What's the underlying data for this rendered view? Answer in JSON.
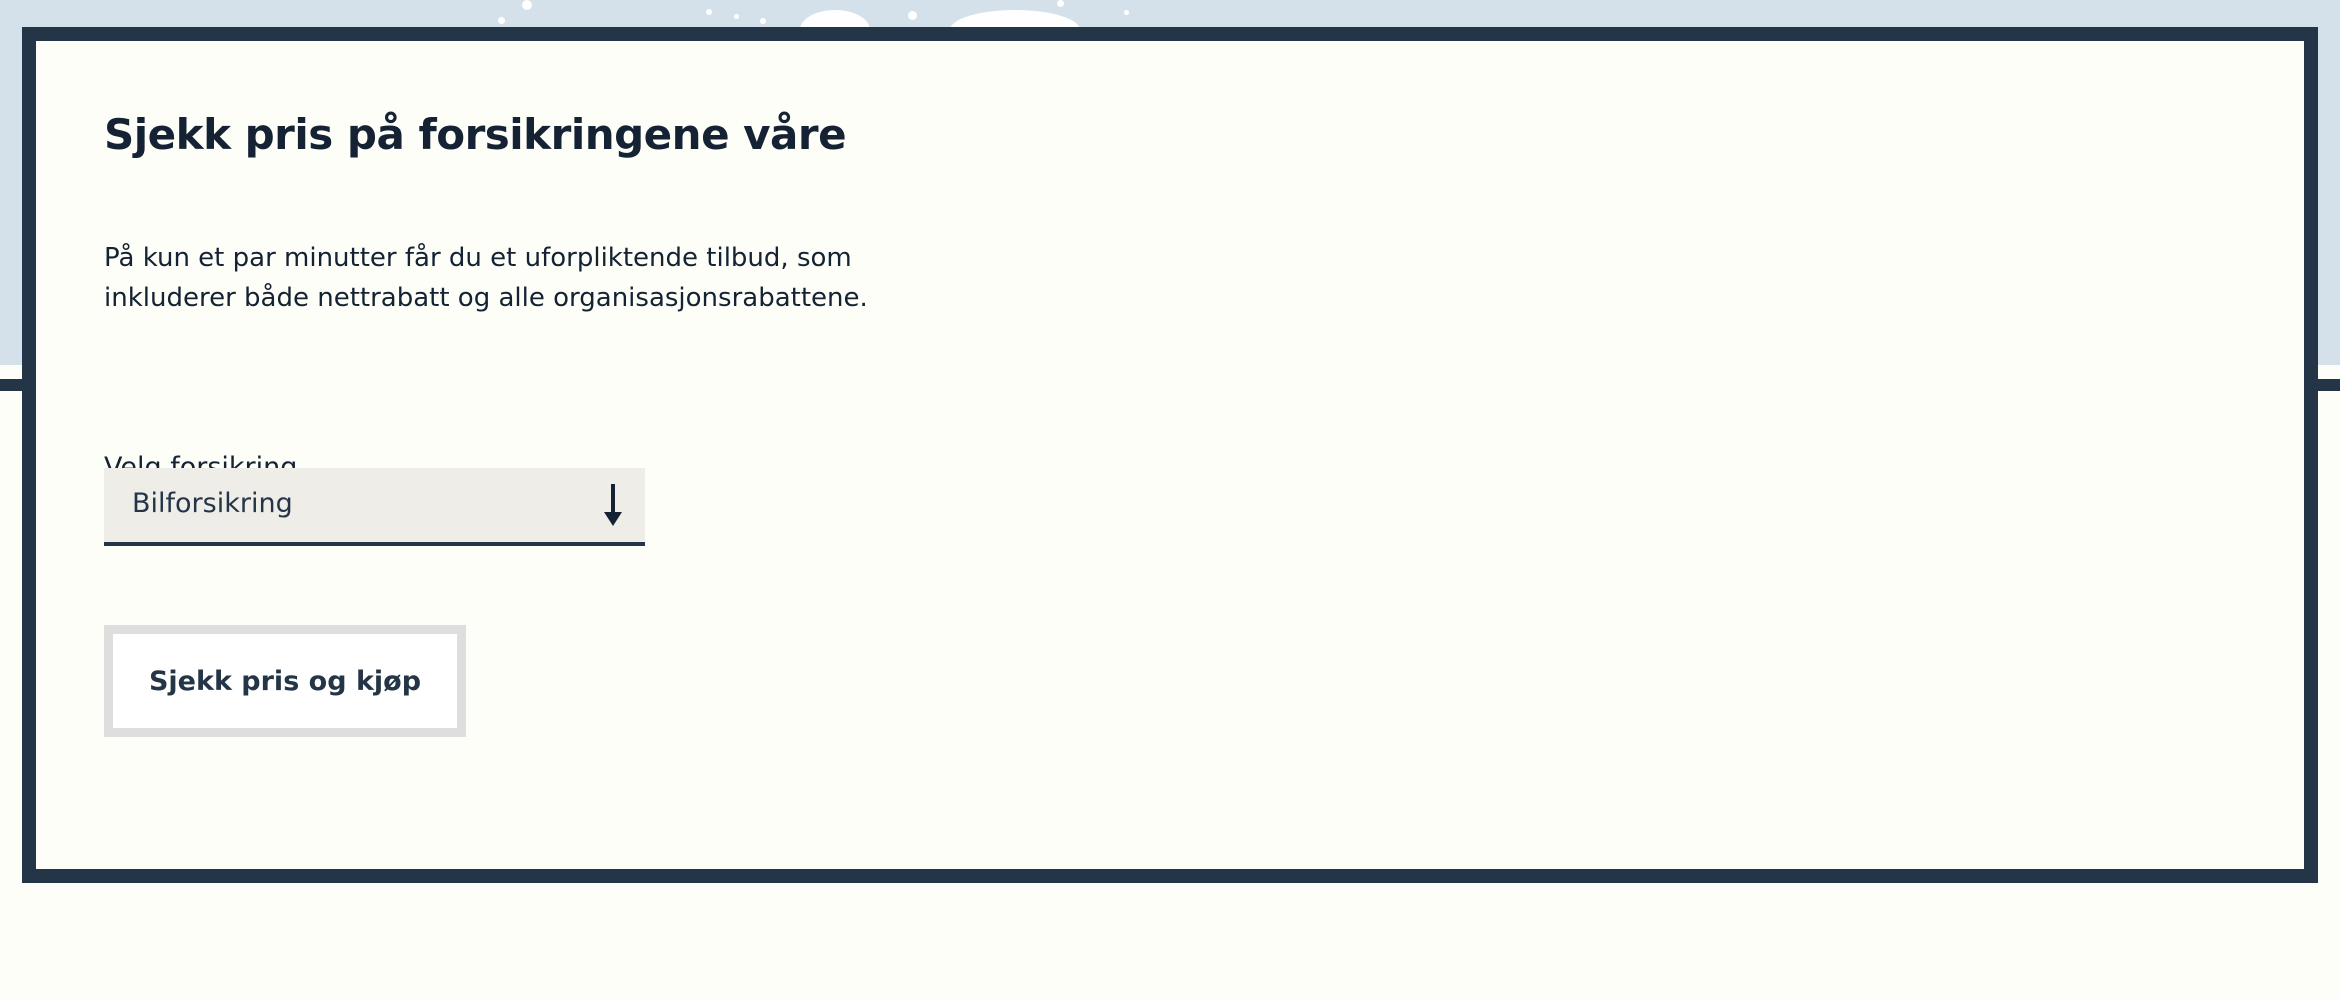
{
  "colors": {
    "background": "#fdfef8",
    "hero_background": "#d5e1ea",
    "panel_border": "#243547",
    "select_background": "#efede8",
    "button_border": "#dedede",
    "text": "#152233"
  },
  "section": {
    "title": "Sjekk pris på forsikringene våre",
    "intro": "På kun et par minutter får du et uforpliktende tilbud, som inkluderer både nettrabatt og alle organisasjonsrabattene."
  },
  "insurance_select": {
    "label": "Velg forsikring",
    "selected_value": "Bilforsikring",
    "icon": "arrow-down-icon"
  },
  "cta": {
    "label": "Sjekk pris og kjøp"
  }
}
